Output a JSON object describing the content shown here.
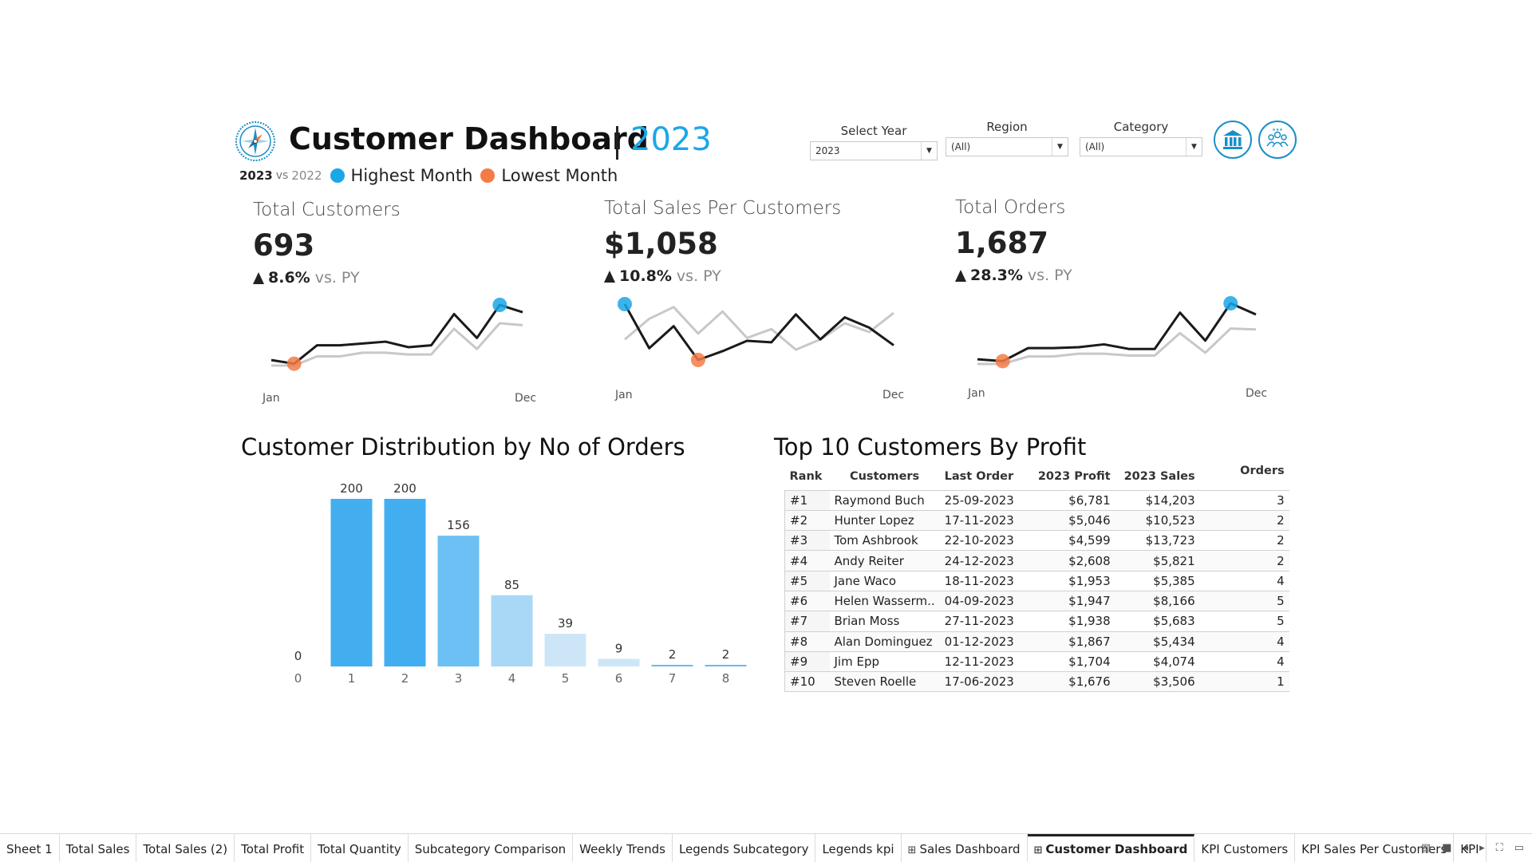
{
  "header": {
    "title": "Customer Dashboard",
    "year": "2023",
    "compare_current": "2023",
    "compare_vs": "vs",
    "compare_previous": "2022",
    "legend_high": "Highest Month",
    "legend_low": "Lowest Month",
    "colors": {
      "accent": "#1aa7e8",
      "high": "#1aa7e8",
      "low": "#f47b45"
    }
  },
  "filters": [
    {
      "label": "Select Year",
      "value": "2023"
    },
    {
      "label": "Region",
      "value": "(All)"
    },
    {
      "label": "Category",
      "value": "(All)"
    }
  ],
  "nav_icons": [
    "bank-icon",
    "people-icon"
  ],
  "kpis": [
    {
      "title": "Total Customers",
      "value": "693",
      "delta": "8.6%",
      "vs": "vs. PY",
      "x_start": "Jan",
      "x_end": "Dec"
    },
    {
      "title": "Total Sales Per Customers",
      "value": "$1,058",
      "delta": "10.8%",
      "vs": "vs. PY",
      "x_start": "Jan",
      "x_end": "Dec"
    },
    {
      "title": "Total Orders",
      "value": "1,687",
      "delta": "28.3%",
      "vs": "vs. PY",
      "x_start": "Jan",
      "x_end": "Dec"
    }
  ],
  "distribution": {
    "title": "Customer Distribution by No of Orders"
  },
  "top_customers": {
    "title": "Top 10 Customers By Profit",
    "columns": [
      "Rank",
      "Customers",
      "Last Order",
      "2023 Profit",
      "2023 Sales",
      "Orders"
    ],
    "rows": [
      [
        "#1",
        "Raymond Buch",
        "25-09-2023",
        "$6,781",
        "$14,203",
        "3"
      ],
      [
        "#2",
        "Hunter Lopez",
        "17-11-2023",
        "$5,046",
        "$10,523",
        "2"
      ],
      [
        "#3",
        "Tom Ashbrook",
        "22-10-2023",
        "$4,599",
        "$13,723",
        "2"
      ],
      [
        "#4",
        "Andy Reiter",
        "24-12-2023",
        "$2,608",
        "$5,821",
        "2"
      ],
      [
        "#5",
        "Jane Waco",
        "18-11-2023",
        "$1,953",
        "$5,385",
        "4"
      ],
      [
        "#6",
        "Helen Wasserm..",
        "04-09-2023",
        "$1,947",
        "$8,166",
        "5"
      ],
      [
        "#7",
        "Brian Moss",
        "27-11-2023",
        "$1,938",
        "$5,683",
        "5"
      ],
      [
        "#8",
        "Alan Dominguez",
        "01-12-2023",
        "$1,867",
        "$5,434",
        "4"
      ],
      [
        "#9",
        "Jim Epp",
        "12-11-2023",
        "$1,704",
        "$4,074",
        "4"
      ],
      [
        "#10",
        "Steven Roelle",
        "17-06-2023",
        "$1,676",
        "$3,506",
        "1"
      ]
    ]
  },
  "tabs": [
    {
      "label": "Sheet 1",
      "icon": ""
    },
    {
      "label": "Total Sales",
      "icon": ""
    },
    {
      "label": "Total Sales (2)",
      "icon": ""
    },
    {
      "label": "Total Profit",
      "icon": ""
    },
    {
      "label": "Total Quantity",
      "icon": ""
    },
    {
      "label": "Subcategory Comparison",
      "icon": ""
    },
    {
      "label": "Weekly Trends",
      "icon": ""
    },
    {
      "label": "Legends Subcategory",
      "icon": ""
    },
    {
      "label": "Legends kpi",
      "icon": ""
    },
    {
      "label": "Sales Dashboard",
      "icon": "dashboard-grid-icon"
    },
    {
      "label": "Customer Dashboard",
      "icon": "dashboard-grid-icon",
      "active": true
    },
    {
      "label": "KPI Customers",
      "icon": ""
    },
    {
      "label": "KPI Sales Per Customers",
      "icon": ""
    },
    {
      "label": "KPI",
      "icon": ""
    }
  ],
  "chart_data": [
    {
      "type": "bar",
      "title": "Customer Distribution by No of Orders",
      "categories": [
        "0",
        "1",
        "2",
        "3",
        "4",
        "5",
        "6",
        "7",
        "8"
      ],
      "values": [
        0,
        200,
        200,
        156,
        85,
        39,
        9,
        2,
        2
      ],
      "colors": [
        "#42aef0",
        "#42aef0",
        "#42aef0",
        "#6cc0f3",
        "#a8d8f6",
        "#cde6f7",
        "#cde6f7",
        "#cde6f7",
        "#cde6f7"
      ],
      "ylim": [
        0,
        200
      ]
    },
    {
      "type": "line",
      "x": [
        "Jan",
        "Feb",
        "Mar",
        "Apr",
        "May",
        "Jun",
        "Jul",
        "Aug",
        "Sep",
        "Oct",
        "Nov",
        "Dec"
      ],
      "series": [
        {
          "values": [
            22,
            20,
            30,
            30,
            31,
            32,
            29,
            30,
            47,
            34,
            52,
            48
          ]
        },
        {
          "values": [
            19,
            19,
            24,
            24,
            26,
            26,
            25,
            25,
            39,
            28,
            42,
            41
          ]
        }
      ],
      "highlight": {
        "high": 10,
        "low": 1
      }
    },
    {
      "type": "line",
      "x": [
        "Jan",
        "Feb",
        "Mar",
        "Apr",
        "May",
        "Jun",
        "Jul",
        "Aug",
        "Sep",
        "Oct",
        "Nov",
        "Dec"
      ],
      "series": [
        {
          "values": [
            1250,
            950,
            1100,
            870,
            930,
            1000,
            990,
            1180,
            1010,
            1160,
            1090,
            970
          ]
        },
        {
          "values": [
            1010,
            1150,
            1230,
            1050,
            1200,
            1020,
            1080,
            940,
            1010,
            1120,
            1060,
            1190
          ]
        }
      ],
      "highlight": {
        "high": 0,
        "low": 3
      }
    },
    {
      "type": "line",
      "x": [
        "Jan",
        "Feb",
        "Mar",
        "Apr",
        "May",
        "Jun",
        "Jul",
        "Aug",
        "Sep",
        "Oct",
        "Nov",
        "Dec"
      ],
      "series": [
        {
          "values": [
            100,
            98,
            112,
            112,
            113,
            116,
            111,
            111,
            150,
            120,
            160,
            148
          ]
        },
        {
          "values": [
            95,
            95,
            103,
            103,
            106,
            106,
            104,
            104,
            128,
            107,
            133,
            132
          ]
        }
      ],
      "highlight": {
        "high": 10,
        "low": 1
      }
    }
  ]
}
